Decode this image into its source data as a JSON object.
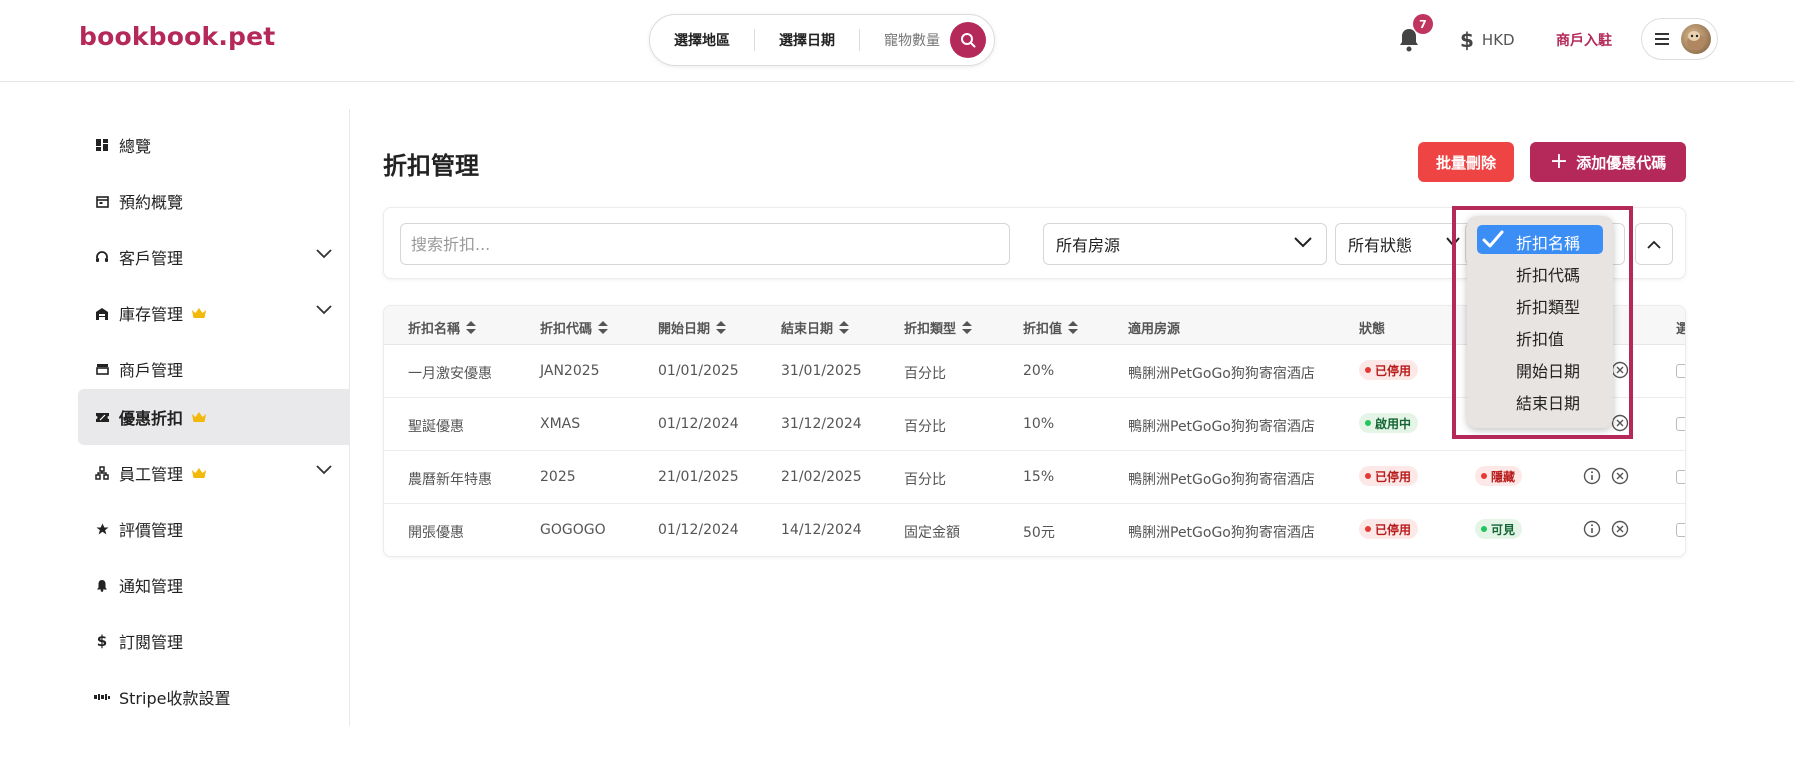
{
  "header": {
    "logo": "bookbook.pet",
    "search": {
      "region": "選擇地區",
      "date": "選擇日期",
      "pets": "寵物數量"
    },
    "notification_count": "7",
    "currency": "HKD",
    "merchant_link": "商戶入駐"
  },
  "sidebar": {
    "items": [
      {
        "label": "總覽",
        "icon": "dashboard-icon"
      },
      {
        "label": "預約概覽",
        "icon": "calendar-icon"
      },
      {
        "label": "客戶管理",
        "icon": "headset-icon",
        "expandable": true
      },
      {
        "label": "庫存管理",
        "icon": "warehouse-icon",
        "premium": true,
        "expandable": true
      },
      {
        "label": "商戶管理",
        "icon": "store-icon"
      },
      {
        "label": "優惠折扣",
        "icon": "ticket-icon",
        "premium": true,
        "active": true
      },
      {
        "label": "員工管理",
        "icon": "team-icon",
        "premium": true,
        "expandable": true
      },
      {
        "label": "評價管理",
        "icon": "star-icon"
      },
      {
        "label": "通知管理",
        "icon": "bell-icon"
      },
      {
        "label": "訂閱管理",
        "icon": "dollar-icon"
      },
      {
        "label": "Stripe收款設置",
        "icon": "stripe-icon"
      }
    ]
  },
  "main": {
    "title": "折扣管理",
    "bulk_delete": "批量刪除",
    "add_coupon": "添加優惠代碼",
    "filters": {
      "search_placeholder": "搜索折扣...",
      "property": "所有房源",
      "status": "所有狀態"
    },
    "table": {
      "columns": [
        "折扣名稱",
        "折扣代碼",
        "開始日期",
        "結束日期",
        "折扣類型",
        "折扣值",
        "適用房源",
        "狀態",
        "選"
      ],
      "rows": [
        {
          "name": "一月激安優惠",
          "code": "JAN2025",
          "start": "01/01/2025",
          "end": "31/01/2025",
          "type": "百分比",
          "value": "20%",
          "property": "鴨脷洲PetGoGo狗狗寄宿酒店",
          "status": "已停用",
          "status_color": "red",
          "visibility": "",
          "visibility_color": ""
        },
        {
          "name": "聖誕優惠",
          "code": "XMAS",
          "start": "01/12/2024",
          "end": "31/12/2024",
          "type": "百分比",
          "value": "10%",
          "property": "鴨脷洲PetGoGo狗狗寄宿酒店",
          "status": "啟用中",
          "status_color": "green",
          "visibility": "",
          "visibility_color": ""
        },
        {
          "name": "農曆新年特惠",
          "code": "2025",
          "start": "21/01/2025",
          "end": "21/02/2025",
          "type": "百分比",
          "value": "15%",
          "property": "鴨脷洲PetGoGo狗狗寄宿酒店",
          "status": "已停用",
          "status_color": "red",
          "visibility": "隱藏",
          "visibility_color": "red"
        },
        {
          "name": "開張優惠",
          "code": "GOGOGO",
          "start": "01/12/2024",
          "end": "14/12/2024",
          "type": "固定金額",
          "value": "50元",
          "property": "鴨脷洲PetGoGo狗狗寄宿酒店",
          "status": "已停用",
          "status_color": "red",
          "visibility": "可見",
          "visibility_color": "green"
        }
      ]
    },
    "sort_dropdown": {
      "options": [
        "折扣名稱",
        "折扣代碼",
        "折扣類型",
        "折扣值",
        "開始日期",
        "結束日期"
      ],
      "selected": "折扣名稱"
    }
  },
  "colors": {
    "brand": "#b5295a",
    "danger": "#ef4444",
    "select_blue": "#3b8ef5"
  }
}
